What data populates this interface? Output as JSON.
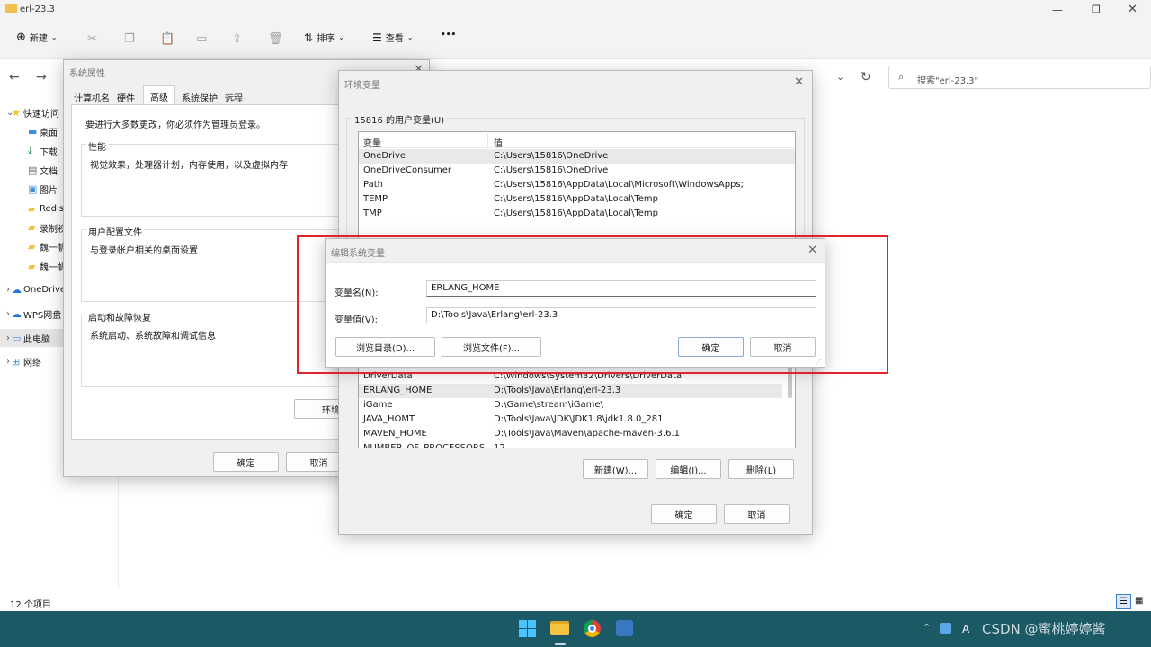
{
  "explorer": {
    "title": "erl-23.3",
    "toolbar": {
      "new_label": "新建",
      "sort_label": "排序",
      "view_label": "查看",
      "more_label": "•••"
    },
    "search_placeholder": "搜索\"erl-23.3\"",
    "sidebar": [
      {
        "label": "快速访问",
        "icon": "star-icon"
      },
      {
        "label": "桌面",
        "icon": "desktop-icon"
      },
      {
        "label": "下载",
        "icon": "download-icon"
      },
      {
        "label": "文档",
        "icon": "document-icon"
      },
      {
        "label": "图片",
        "icon": "picture-icon"
      },
      {
        "label": "Redis",
        "icon": "folder-icon"
      },
      {
        "label": "录制视",
        "icon": "folder-icon"
      },
      {
        "label": "魏一帆",
        "icon": "folder-icon"
      },
      {
        "label": "魏一帆",
        "icon": "folder-icon"
      },
      {
        "label": "OneDrive",
        "icon": "cloud-icon"
      },
      {
        "label": "WPS网盘",
        "icon": "cloud-icon"
      },
      {
        "label": "此电脑",
        "icon": "computer-icon"
      },
      {
        "label": "网络",
        "icon": "network-icon"
      }
    ],
    "status_count": "12 个项目"
  },
  "sysprops": {
    "title": "系统属性",
    "tabs": [
      "计算机名",
      "硬件",
      "高级",
      "系统保护",
      "远程"
    ],
    "admin_note": "要进行大多数更改，你必须作为管理员登录。",
    "perf_label": "性能",
    "perf_desc": "视觉效果，处理器计划，内存使用，以及虚拟内存",
    "profile_label": "用户配置文件",
    "profile_desc": "与登录帐户相关的桌面设置",
    "startup_label": "启动和故障恢复",
    "startup_desc": "系统启动、系统故障和调试信息",
    "env_button": "环境",
    "ok": "确定",
    "cancel": "取消"
  },
  "envvars": {
    "title": "环境变量",
    "user_group": "15816 的用户变量(U)",
    "col_var": "变量",
    "col_val": "值",
    "user_rows": [
      {
        "name": "OneDrive",
        "value": "C:\\Users\\15816\\OneDrive"
      },
      {
        "name": "OneDriveConsumer",
        "value": "C:\\Users\\15816\\OneDrive"
      },
      {
        "name": "Path",
        "value": "C:\\Users\\15816\\AppData\\Local\\Microsoft\\WindowsApps;"
      },
      {
        "name": "TEMP",
        "value": "C:\\Users\\15816\\AppData\\Local\\Temp"
      },
      {
        "name": "TMP",
        "value": "C:\\Users\\15816\\AppData\\Local\\Temp"
      }
    ],
    "sys_rows": [
      {
        "name": "DriverData",
        "value": "C:\\Windows\\System32\\Drivers\\DriverData"
      },
      {
        "name": "ERLANG_HOME",
        "value": "D:\\Tools\\Java\\Erlang\\erl-23.3"
      },
      {
        "name": "iGame",
        "value": "D:\\Game\\stream\\iGame\\"
      },
      {
        "name": "JAVA_HOMT",
        "value": "D:\\Tools\\Java\\JDK\\JDK1.8\\jdk1.8.0_281"
      },
      {
        "name": "MAVEN_HOME",
        "value": "D:\\Tools\\Java\\Maven\\apache-maven-3.6.1"
      },
      {
        "name": "NUMBER_OF_PROCESSORS",
        "value": "12"
      }
    ],
    "new_btn": "新建(W)...",
    "edit_btn": "编辑(I)...",
    "delete_btn": "删除(L)",
    "ok": "确定",
    "cancel": "取消"
  },
  "editdlg": {
    "title": "编辑系统变量",
    "name_label": "变量名(N):",
    "name_value": "ERLANG_HOME",
    "value_label": "变量值(V):",
    "value_value": "D:\\Tools\\Java\\Erlang\\erl-23.3",
    "browse_dir": "浏览目录(D)...",
    "browse_file": "浏览文件(F)...",
    "ok": "确定",
    "cancel": "取消"
  },
  "taskbar": {
    "tray_lang": "A",
    "watermark": "CSDN @蜜桃婷婷酱"
  },
  "colors": {
    "highlight_box": "#e0242a",
    "taskbar": "#1b5965"
  }
}
